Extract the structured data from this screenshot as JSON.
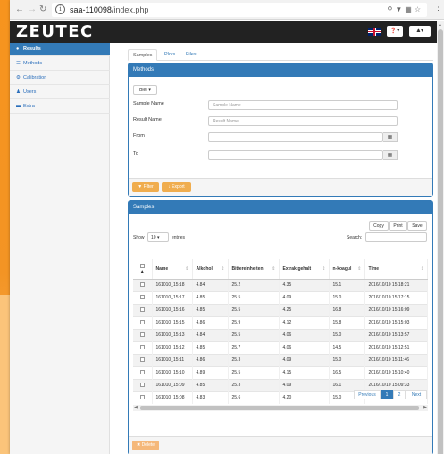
{
  "browser": {
    "url_host": "saa-110098",
    "url_path": "/index.php"
  },
  "app": {
    "logo": "ZEUTEC",
    "help_label": "❓▾",
    "user_label": "♟▾"
  },
  "sidebar": {
    "items": [
      {
        "label": "Results",
        "icon": "●"
      },
      {
        "label": "Methods",
        "icon": "☰"
      },
      {
        "label": "Calibration",
        "icon": "⚙"
      },
      {
        "label": "Users",
        "icon": "♟"
      },
      {
        "label": "Extra",
        "icon": "▬"
      }
    ]
  },
  "tabs": [
    "Samples",
    "Plots",
    "Files"
  ],
  "methods_panel": {
    "title": "Methods",
    "dropdown": "Bier ▾",
    "fields": [
      {
        "label": "Sample Name",
        "placeholder": "Sample Name"
      },
      {
        "label": "Result Name",
        "placeholder": "Result Name"
      },
      {
        "label": "From",
        "placeholder": ""
      },
      {
        "label": "To",
        "placeholder": ""
      }
    ],
    "filter_label": "Filter",
    "export_label": "Export"
  },
  "samples_panel": {
    "title": "Samples",
    "buttons": [
      "Copy",
      "Print",
      "Save"
    ],
    "show_label": "Show",
    "entries_value": "10",
    "entries_label": "entries",
    "search_label": "Search:",
    "columns": [
      "Name",
      "Alkohol",
      "Bittereinheiten",
      "Extraktgehalt",
      "n-koagul",
      "Time"
    ],
    "rows": [
      [
        "161010_15:18",
        "4.84",
        "25.2",
        "4.35",
        "15.1",
        "2016/10/10 15:18:21"
      ],
      [
        "161010_15:17",
        "4.85",
        "25.5",
        "4.09",
        "15.0",
        "2016/10/10 15:17:15"
      ],
      [
        "161010_15:16",
        "4.85",
        "25.5",
        "4.25",
        "16.8",
        "2016/10/10 15:16:09"
      ],
      [
        "161010_15:15",
        "4.86",
        "25.9",
        "4.12",
        "15.8",
        "2016/10/10 15:15:03"
      ],
      [
        "161010_15:13",
        "4.84",
        "25.5",
        "4.06",
        "15.0",
        "2016/10/10 15:13:57"
      ],
      [
        "161010_15:12",
        "4.85",
        "25.7",
        "4.06",
        "14.5",
        "2016/10/10 15:12:51"
      ],
      [
        "161010_15:11",
        "4.86",
        "25.3",
        "4.09",
        "15.0",
        "2016/10/10 15:11:46"
      ],
      [
        "161010_15:10",
        "4.89",
        "25.5",
        "4.15",
        "16.5",
        "2016/10/10 15:10:40"
      ],
      [
        "161010_15:09",
        "4.85",
        "25.3",
        "4.09",
        "16.1",
        "2016/10/10 15:09:33"
      ],
      [
        "161010_15:08",
        "4.83",
        "25.6",
        "4.20",
        "15.0",
        "2016/10/10 15:08:28"
      ]
    ],
    "pagination": {
      "previous": "Previous",
      "pages": [
        "1",
        "2"
      ],
      "next": "Next"
    },
    "delete_label": "Delete"
  }
}
